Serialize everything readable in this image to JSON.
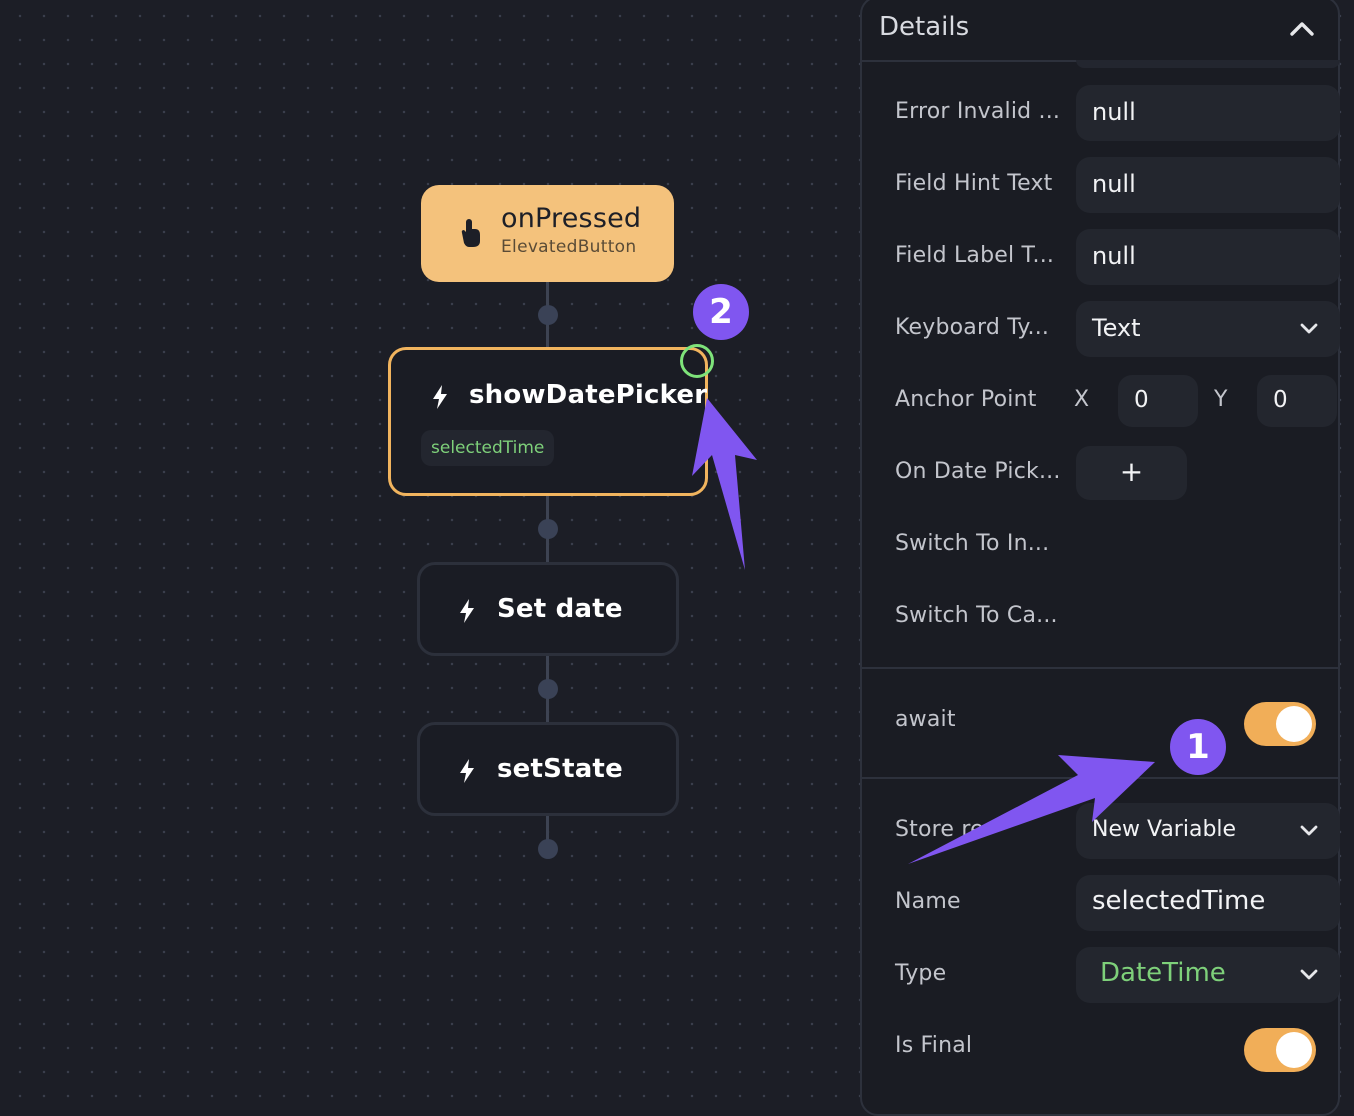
{
  "flow": {
    "trigger": {
      "title": "onPressed",
      "subtitle": "ElevatedButton"
    },
    "actions": [
      {
        "title": "showDatePicker",
        "output_variable": "selectedTime",
        "selected": true
      },
      {
        "title": "Set date"
      },
      {
        "title": "setState"
      }
    ]
  },
  "annotations": {
    "badge_1": "1",
    "badge_2": "2"
  },
  "details": {
    "title": "Details",
    "rows": {
      "error_invalid": {
        "label": "Error Invalid ...",
        "value": "null"
      },
      "field_hint": {
        "label": "Field Hint Text",
        "value": "null"
      },
      "field_label": {
        "label": "Field Label T...",
        "value": "null"
      },
      "keyboard_type": {
        "label": "Keyboard Ty...",
        "value": "Text"
      },
      "anchor_point": {
        "label": "Anchor Point",
        "x_label": "X",
        "x_value": "0",
        "y_label": "Y",
        "y_value": "0"
      },
      "on_date_picked": {
        "label": "On Date Pick...",
        "button": "+"
      },
      "switch_to_input": {
        "label": "Switch To In..."
      },
      "switch_to_calendar": {
        "label": "Switch To Ca..."
      }
    },
    "await": {
      "label": "await",
      "enabled": true
    },
    "store_result": {
      "label": "Store re",
      "value": "New Variable"
    },
    "name": {
      "label": "Name",
      "value": "selectedTime"
    },
    "type": {
      "label": "Type",
      "value": "DateTime",
      "value_color": "#7ed07a"
    },
    "is_final": {
      "label": "Is Final",
      "enabled": true
    }
  },
  "colors": {
    "canvas": "#1c1e26",
    "trigger_bg": "#f4c27c",
    "selected_border": "#f1b45e",
    "toggle_on": "#f1ae58",
    "annotation": "#8056f0",
    "variable_green": "#7ed07a"
  }
}
